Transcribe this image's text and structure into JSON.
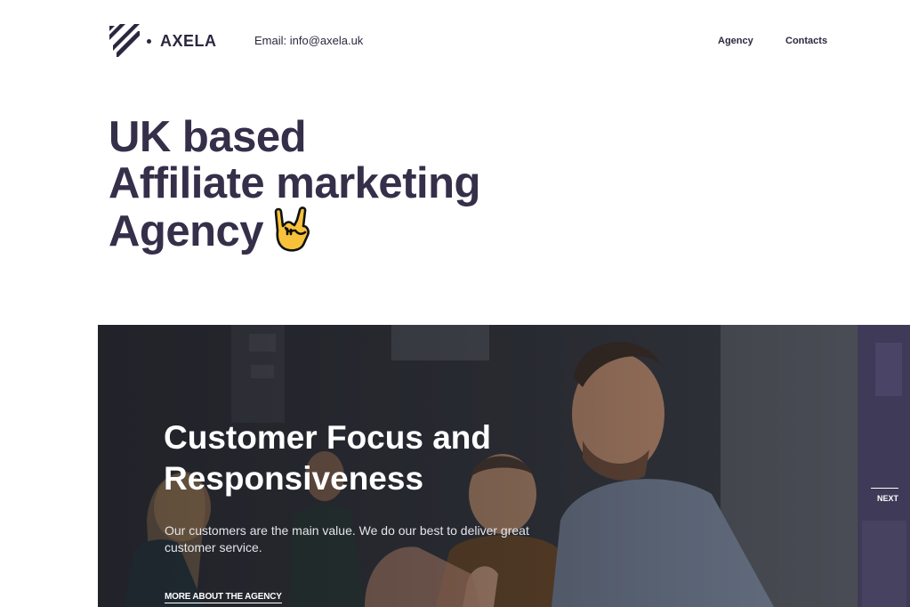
{
  "brand": {
    "name": "AXELA"
  },
  "header": {
    "email": "Email: info@axela.uk",
    "nav": [
      {
        "label": "Agency"
      },
      {
        "label": "Contacts"
      }
    ]
  },
  "hero": {
    "lines": [
      "UK based",
      "Affiliate marketing",
      "Agency"
    ],
    "emoji_icon": "sign-of-the-horns-hand-icon"
  },
  "slide": {
    "title_line1": "Customer Focus and",
    "title_line2": "Responsiveness",
    "text": "Our customers are the main value. We do our best to deliver great customer service.",
    "link": "MORE ABOUT THE AGENCY",
    "next_label": "NEXT"
  },
  "colors": {
    "text": "#2c2740",
    "hero_text": "#352f4a",
    "next_panel": "#3f3a57",
    "emoji": "#f7c23a"
  }
}
